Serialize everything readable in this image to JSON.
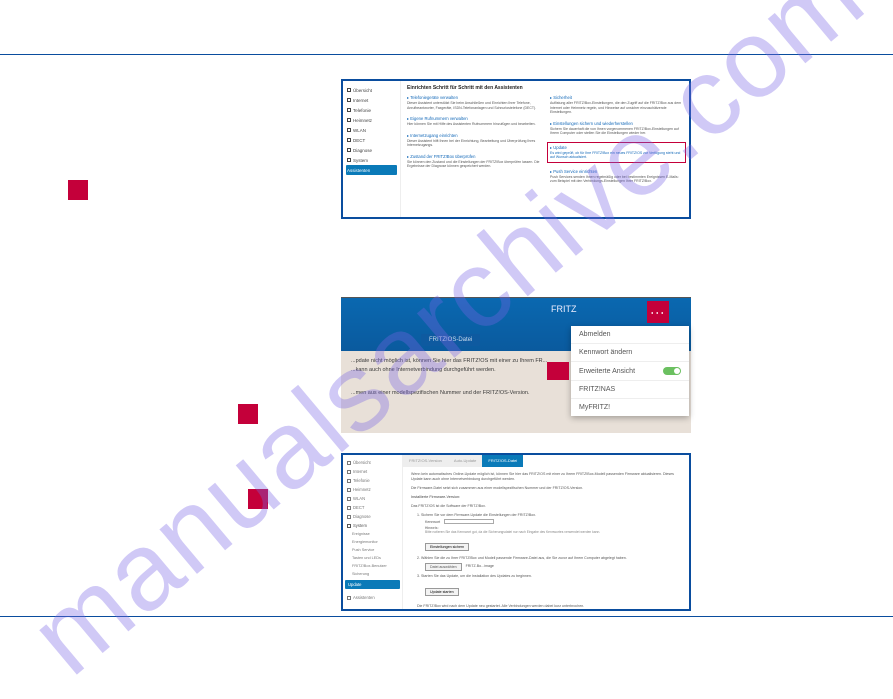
{
  "watermark": "manualsarchive.com",
  "labels": {
    "txt1": " ",
    "txt2": " ",
    "sectionB": " "
  },
  "markers": {
    "m1": "",
    "m2": "",
    "m3": ""
  },
  "fig1": {
    "sidebar": {
      "items": [
        {
          "label": "Übersicht"
        },
        {
          "label": "Internet"
        },
        {
          "label": "Telefonie"
        },
        {
          "label": "Heimnetz"
        },
        {
          "label": "WLAN"
        },
        {
          "label": "DECT"
        },
        {
          "label": "Diagnose"
        },
        {
          "label": "System"
        }
      ],
      "active": "Assistenten"
    },
    "title": "Einrichten Schritt für Schritt mit den Assistenten",
    "left": [
      {
        "title": "Telefoniegeräte verwalten",
        "desc": "Dieser Assistent unterstützt Sie beim Anschließen und Einrichten Ihrer Telefone, Anrufbeantworter, Faxgeräte, ISDN-Telefonanlagen und Schnurlostelefone (DECT)."
      },
      {
        "title": "Eigene Rufnummern verwalten",
        "desc": "Hier können Sie mit Hilfe des Assistenten Rufnummern hinzufügen und bearbeiten."
      },
      {
        "title": "Internetzugang einrichten",
        "desc": "Dieser Assistent hilft Ihnen bei der Einrichtung, Bearbeitung und Überprüfung Ihres Internetzugangs."
      },
      {
        "title": "Zustand der FRITZ!Box überprüfen",
        "desc": "Sie können den Zustand und die Einstellungen der FRITZ!Box überprüfen lassen. Die Ergebnisse der Diagnose können gespeichert werden."
      }
    ],
    "right": [
      {
        "title": "Sicherheit",
        "desc": "Auflistung aller FRITZ!Box-Einstellungen, die den Zugriff auf die FRITZ!Box aus dem Internet oder Heimnetz regeln, und Hinweise auf unsicher einzuschätzende Einstellungen."
      },
      {
        "title": "Einstellungen sichern und wiederherstellen",
        "desc": "Sichern Sie dauerhaft die von Ihnen vorgenommenen FRITZ!Box-Einstellungen auf Ihrem Computer oder stellen Sie die Einstellungen wieder her."
      },
      {
        "title": "Update",
        "desc": "Es wird geprüft, ob für Ihre FRITZ!Box ein neues FRITZ!OS zur Verfügung steht und auf Wunsch aktualisiert.",
        "highlight": true
      },
      {
        "title": "Push Service einrichten",
        "desc": "Push Services senden Ihnen regelmäßig oder bei bestimmten Ereignissen E-Mails: zum Beispiel mit den Verbindungs-Einstellungen Ihrer FRITZ!Box."
      }
    ]
  },
  "fig2": {
    "header_title": "FRITZ",
    "tab": "FRITZ!OS-Datei",
    "body_line1": "...pdate nicht möglich ist, können Sie hier das FRITZ!OS mit einer zu Ihrem FR...",
    "body_line2": "...kann auch ohne Internetverbindung durchgeführt werden.",
    "body_line3": "...men aus einer modellspezifischen Nummer und der FRITZ!OS-Version.",
    "menu": [
      {
        "label": "Abmelden"
      },
      {
        "label": "Kennwort ändern"
      },
      {
        "label": "Erweiterte Ansicht",
        "toggle": true,
        "highlight": true
      },
      {
        "label": "FRITZ!NAS"
      },
      {
        "label": "MyFRITZ!"
      }
    ]
  },
  "fig3": {
    "sidebar": {
      "items": [
        {
          "label": "Übersicht"
        },
        {
          "label": "Internet"
        },
        {
          "label": "Telefonie"
        },
        {
          "label": "Heimnetz"
        },
        {
          "label": "WLAN"
        },
        {
          "label": "DECT"
        },
        {
          "label": "Diagnose"
        },
        {
          "label": "System",
          "section": true
        },
        {
          "label": "Ereignisse",
          "sub": true
        },
        {
          "label": "Energiemonitor",
          "sub": true
        },
        {
          "label": "Push Service",
          "sub": true
        },
        {
          "label": "Tasten und LEDs",
          "sub": true
        },
        {
          "label": "FRITZ!Box-Benutzer",
          "sub": true
        },
        {
          "label": "Sicherung",
          "sub": true
        }
      ],
      "active_hl": "Update",
      "bottom": "Assistenten"
    },
    "tabs": [
      {
        "label": "FRITZ!OS-Version"
      },
      {
        "label": "Auto-Update"
      },
      {
        "label": "FRITZ!OS-Datei",
        "active": true
      }
    ],
    "intro1": "Wenn kein automatisches Online-Update möglich ist, können Sie hier das FRITZ!OS mit einer zu Ihrem FRITZ!Box-Modell passenden Firmware aktualisieren. Dieses Update kann auch ohne Internetverbindung durchgeführt werden.",
    "intro2": "Die Firmware-Datei setzt sich zusammen aus einer modellspezifischen Nummer und der FRITZ!OS-Version.",
    "installed_label": "Installierte Firmware-Version:",
    "installed_value": " ",
    "section_label": "Das FRITZ!OS ist die Software der FRITZ!Box.",
    "step1": "1. Sichern Sie vor dem Firmware-Update die Einstellungen der FRITZ!Box.",
    "kennwort_label": "Kennwort",
    "kennwort_value": "****",
    "hint_heading": "Hinweis:",
    "hint_text": "Bitte notieren Sie das Kennwort gut, da die Sicherungsdatei nur nach Eingabe des Kennwortes verwendet werden kann.",
    "btn_save": "Einstellungen sichern",
    "step2": "2. Wählen Sie die zu Ihrer FRITZ!Box und Modell passende Firmware-Datei aus, die Sie zuvor auf Ihrem Computer abgelegt haben.",
    "file_row_label": "Datei auswählen",
    "file_row_value": "FRITZ.Bo...image",
    "step3": "3. Starten Sie das Update, um die Installation des Updates zu beginnen.",
    "btn_start": "Update starten",
    "footer": "Die FRITZ!Box wird nach dem Update neu gestartet. Alle Verbindungen werden dabei kurz unterbrochen."
  }
}
